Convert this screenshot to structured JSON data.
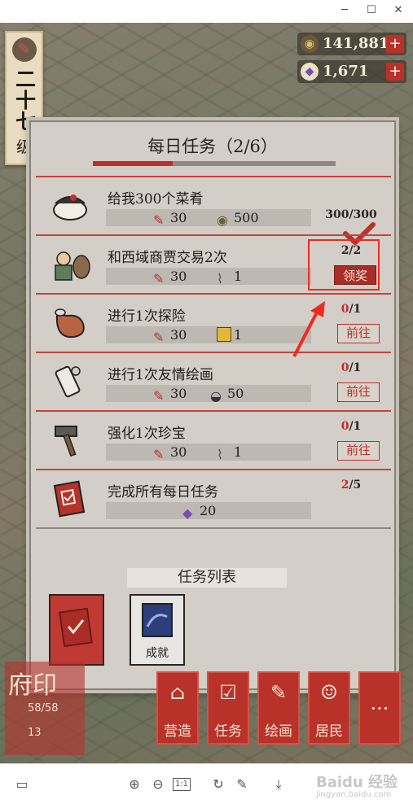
{
  "window": {
    "minimize_icon": "minimize-icon",
    "maximize_icon": "maximize-icon",
    "close_icon": "close-icon"
  },
  "level": {
    "number_text": "二十七",
    "suffix": "级"
  },
  "currencies": [
    {
      "icon": "coin-icon",
      "value": "141,881"
    },
    {
      "icon": "gem-icon",
      "value": "1,671"
    }
  ],
  "panel": {
    "title": "每日任务（2/6）",
    "progress_fraction": 0.33,
    "tasks": [
      {
        "name": "给我300个菜肴",
        "icon": "dish-bowl-icon",
        "rewards": [
          {
            "icon": "brush-icon",
            "value": "30"
          },
          {
            "icon": "coin-icon",
            "value": "500"
          }
        ],
        "progress": "300/300",
        "state": "done"
      },
      {
        "name": "和西域商贾交易2次",
        "icon": "merchant-icon",
        "rewards": [
          {
            "icon": "brush-icon",
            "value": "30"
          },
          {
            "icon": "scroll-icon",
            "value": "1"
          }
        ],
        "progress": "2/2",
        "state": "claim",
        "action": "领奖"
      },
      {
        "name": "进行1次探险",
        "icon": "pouch-icon",
        "rewards": [
          {
            "icon": "brush-icon",
            "value": "30"
          },
          {
            "icon": "gold-bar-icon",
            "value": "1"
          }
        ],
        "progress_done": "0",
        "progress_total": "/1",
        "state": "go",
        "action": "前往"
      },
      {
        "name": "进行1次友情绘画",
        "icon": "painting-scroll-icon",
        "rewards": [
          {
            "icon": "brush-icon",
            "value": "30"
          },
          {
            "icon": "dish-bowl-icon",
            "value": "50"
          }
        ],
        "progress_done": "0",
        "progress_total": "/1",
        "state": "go",
        "action": "前往"
      },
      {
        "name": "强化1次珍宝",
        "icon": "hammer-icon",
        "rewards": [
          {
            "icon": "brush-icon",
            "value": "30"
          },
          {
            "icon": "scroll-icon",
            "value": "1"
          }
        ],
        "progress_done": "0",
        "progress_total": "/1",
        "state": "go",
        "action": "前往"
      },
      {
        "name": "完成所有每日任务",
        "icon": "task-book-icon",
        "rewards": [
          {
            "icon": "gem-icon",
            "value": "20"
          }
        ],
        "progress_done": "2",
        "progress_total": "/5",
        "state": "progress"
      }
    ],
    "task_list_title": "任务列表",
    "cards": [
      {
        "name": "daily-task-card",
        "label": ""
      },
      {
        "name": "achievement-card",
        "label": "成就"
      }
    ]
  },
  "bottom_buttons": [
    {
      "icon": "build-icon",
      "label": "营造"
    },
    {
      "icon": "task-icon",
      "label": "任务"
    },
    {
      "icon": "painting-icon",
      "label": "绘画"
    },
    {
      "icon": "resident-icon",
      "label": "居民"
    },
    {
      "icon": "more-icon",
      "label": "···"
    }
  ],
  "seal": {
    "title": "府印",
    "count1": "58/58",
    "count2": "13"
  },
  "viewer_toolbar": {
    "watermark": "Baidu 经验",
    "watermark_sub": "jingyan.baidu.com"
  },
  "colors": {
    "accent_red": "#b8322a",
    "panel_bg": "#d3cec7",
    "highlight_box": "#ee2b1f"
  }
}
